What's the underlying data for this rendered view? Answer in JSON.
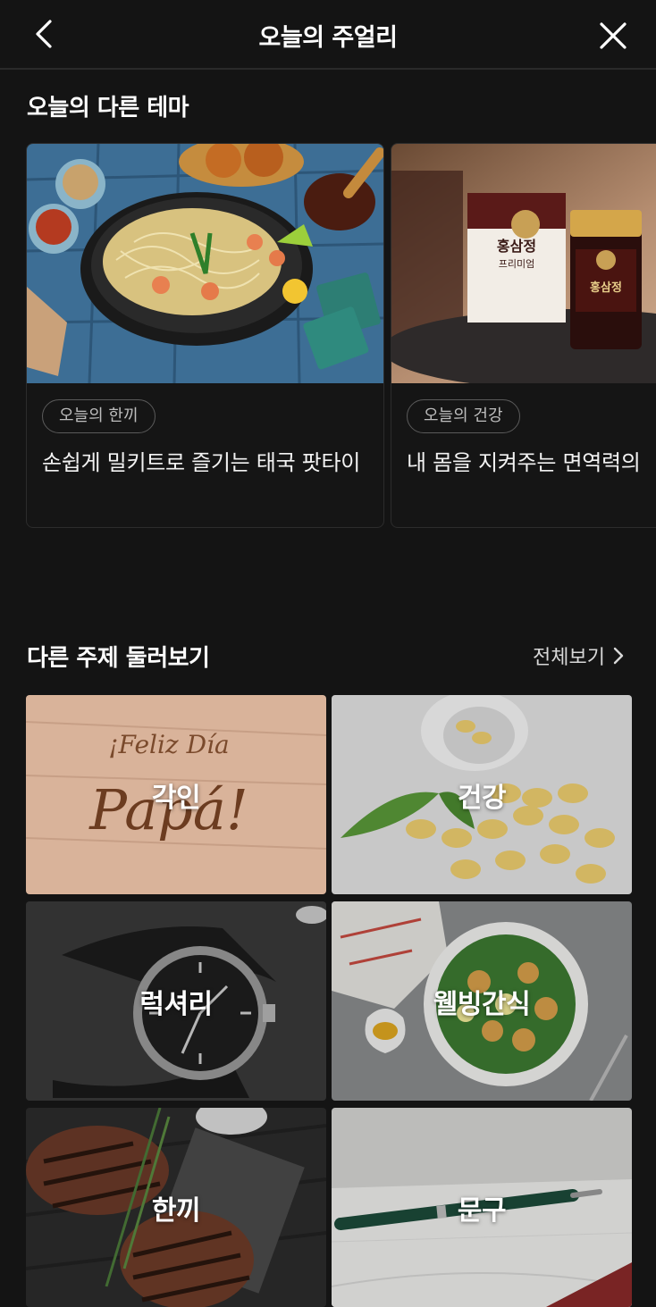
{
  "header": {
    "title": "오늘의 주얼리"
  },
  "themes_section": {
    "title": "오늘의 다른 테마",
    "cards": [
      {
        "chip": "오늘의 한끼",
        "description": "손쉽게 밀키트로 즐기는 태국 팟타이"
      },
      {
        "chip": "오늘의 건강",
        "description": "내 몸을 지켜주는 면역력의"
      }
    ]
  },
  "topics_section": {
    "title": "다른 주제 둘러보기",
    "see_all": "전체보기",
    "tiles": [
      {
        "label": "각인"
      },
      {
        "label": "건강"
      },
      {
        "label": "럭셔리"
      },
      {
        "label": "웰빙간식"
      },
      {
        "label": "한끼"
      },
      {
        "label": "문구"
      }
    ]
  },
  "images": {
    "card_0": {
      "text": ""
    },
    "card_1": {
      "box_text_1": "홍삼정",
      "box_text_2": "프리미엄",
      "jar_text": "홍삼정"
    },
    "tile_0": {
      "engraving_1": "¡Feliz Día",
      "engraving_2": "Papá!"
    }
  }
}
